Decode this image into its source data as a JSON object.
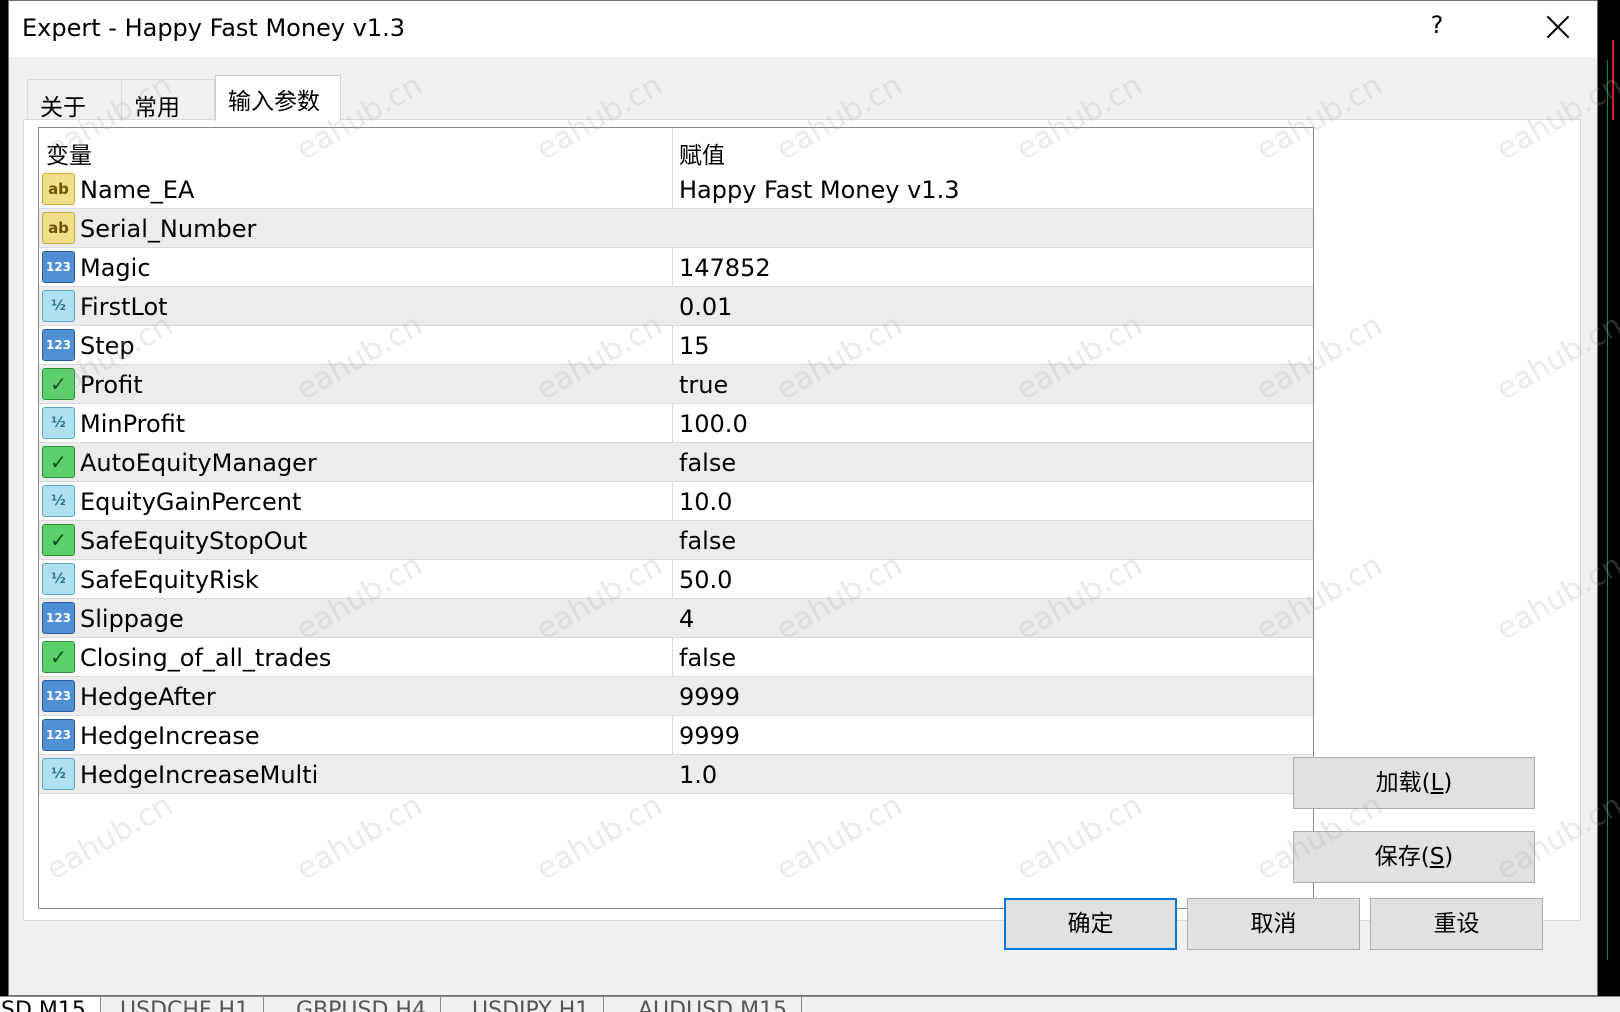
{
  "window": {
    "title": "Expert - Happy Fast Money v1.3",
    "help_glyph": "?"
  },
  "tabs": [
    {
      "label": "关于"
    },
    {
      "label": "常用"
    },
    {
      "label": "输入参数"
    }
  ],
  "grid": {
    "col_variable": "变量",
    "col_value": "赋值",
    "rows": [
      {
        "name": "Name_EA",
        "value": "Happy Fast Money v1.3",
        "type": "ab"
      },
      {
        "name": "Serial_Number",
        "value": "",
        "type": "ab"
      },
      {
        "name": "Magic",
        "value": "147852",
        "type": "num"
      },
      {
        "name": "FirstLot",
        "value": "0.01",
        "type": "frac"
      },
      {
        "name": "Step",
        "value": "15",
        "type": "num"
      },
      {
        "name": "Profit",
        "value": "true",
        "type": "bool"
      },
      {
        "name": "MinProfit",
        "value": "100.0",
        "type": "frac"
      },
      {
        "name": "AutoEquityManager",
        "value": "false",
        "type": "bool"
      },
      {
        "name": "EquityGainPercent",
        "value": "10.0",
        "type": "frac"
      },
      {
        "name": "SafeEquityStopOut",
        "value": "false",
        "type": "bool"
      },
      {
        "name": "SafeEquityRisk",
        "value": "50.0",
        "type": "frac"
      },
      {
        "name": "Slippage",
        "value": "4",
        "type": "num"
      },
      {
        "name": "Closing_of_all_trades",
        "value": "false",
        "type": "bool"
      },
      {
        "name": "HedgeAfter",
        "value": "9999",
        "type": "num"
      },
      {
        "name": "HedgeIncrease",
        "value": "9999",
        "type": "num"
      },
      {
        "name": "HedgeIncreaseMulti",
        "value": "1.0",
        "type": "frac"
      }
    ]
  },
  "buttons": {
    "load_label": "加载(",
    "load_key": "L",
    "load_end": ")",
    "save_label": "保存(",
    "save_key": "S",
    "save_end": ")",
    "ok": "确定",
    "cancel": "取消",
    "reset": "重设"
  },
  "chart_tabs": [
    "SD,M15",
    "USDCHF,H1",
    "GBPUSD,H4",
    "USDJPY,H1",
    "AUDUSD,M15"
  ],
  "watermark": "eahub.cn",
  "icon_glyphs": {
    "ab": "ab",
    "num": "123",
    "frac": "½",
    "bool": "✓"
  },
  "colors": {
    "accent": "#0078d7"
  }
}
